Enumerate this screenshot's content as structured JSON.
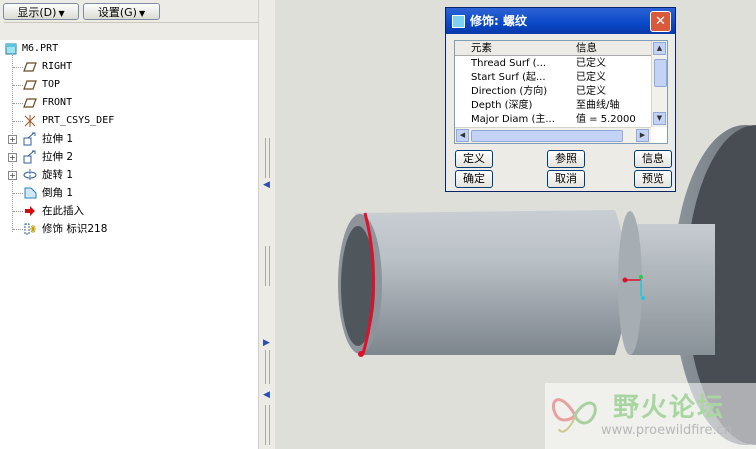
{
  "toolbar": {
    "show_label": "显示(D)",
    "settings_label": "设置(G)"
  },
  "tree": [
    {
      "label": "M6.PRT",
      "icon": "part-icon"
    },
    {
      "label": "RIGHT",
      "icon": "datum-plane-icon"
    },
    {
      "label": "TOP",
      "icon": "datum-plane-icon"
    },
    {
      "label": "FRONT",
      "icon": "datum-plane-icon"
    },
    {
      "label": "PRT_CSYS_DEF",
      "icon": "csys-icon"
    },
    {
      "label": "拉伸 1",
      "icon": "extrude-icon"
    },
    {
      "label": "拉伸 2",
      "icon": "extrude-icon"
    },
    {
      "label": "旋转 1",
      "icon": "revolve-icon"
    },
    {
      "label": "倒角 1",
      "icon": "chamfer-icon"
    },
    {
      "label": "在此插入",
      "icon": "insert-arrow-icon"
    },
    {
      "label": "修饰 标识218",
      "icon": "cosmetic-thread-icon"
    }
  ],
  "dialog": {
    "title": "修饰: 螺纹",
    "columns": [
      "元素",
      "信息"
    ],
    "rows": [
      {
        "element": "Thread Surf (...",
        "info": "已定义"
      },
      {
        "element": "Start Surf (起...",
        "info": "已定义"
      },
      {
        "element": "Direction (方向)",
        "info": "已定义"
      },
      {
        "element": "Depth (深度)",
        "info": "至曲线/轴"
      },
      {
        "element": "Major Diam (主...",
        "info": "值 = 5.2000"
      }
    ],
    "buttons": {
      "define": "定义",
      "refs": "参照",
      "info": "信息",
      "ok": "确定",
      "cancel": "取消",
      "preview": "预览"
    }
  },
  "watermark": {
    "name": "野火论坛",
    "url": "www.proewildfire.cn"
  },
  "colors": {
    "titlebar": "#0a48c8",
    "thread_edge": "#e0102a",
    "model_gray": "#b9c0c6"
  }
}
